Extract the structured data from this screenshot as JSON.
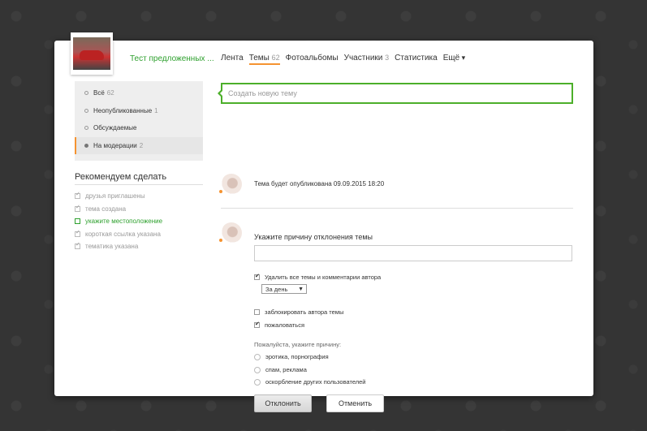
{
  "group": {
    "title": "Тест предложенных ..."
  },
  "nav": {
    "tabs": [
      {
        "label": "Лента",
        "count": ""
      },
      {
        "label": "Темы",
        "count": "62"
      },
      {
        "label": "Фотоальбомы",
        "count": ""
      },
      {
        "label": "Участники",
        "count": "3"
      },
      {
        "label": "Статистика",
        "count": ""
      },
      {
        "label": "Ещё",
        "count": ""
      }
    ]
  },
  "sidebar": {
    "filters": [
      {
        "label": "Всё",
        "count": "62"
      },
      {
        "label": "Неопубликованные",
        "count": "1"
      },
      {
        "label": "Обсуждаемые",
        "count": ""
      },
      {
        "label": "На модерации",
        "count": "2"
      }
    ],
    "recommend_title": "Рекомендуем сделать",
    "recommend_items": [
      "друзья приглашены",
      "тема создана",
      "укажите местоположение",
      "короткая ссылка указана",
      "тематика указана"
    ]
  },
  "main": {
    "create_placeholder": "Создать новую тему",
    "post1_text": "Тема будет опубликована 09.09.2015 18:20",
    "reason_title": "Укажите причину отклонения темы",
    "delete_all_label": "Удалить все темы и комментарии автора",
    "period_select": "За день",
    "block_author_label": "заблокировать автора темы",
    "complain_label": "пожаловаться",
    "reason_prompt": "Пожалуйста, укажите причину:",
    "reasons": [
      "эротика, порнография",
      "спам, реклама",
      "оскорбление других пользователей"
    ],
    "reject_button": "Отклонить",
    "cancel_button": "Отменить"
  },
  "colors": {
    "accent": "#f59331",
    "green": "#2ea02e",
    "background": "#343434"
  }
}
